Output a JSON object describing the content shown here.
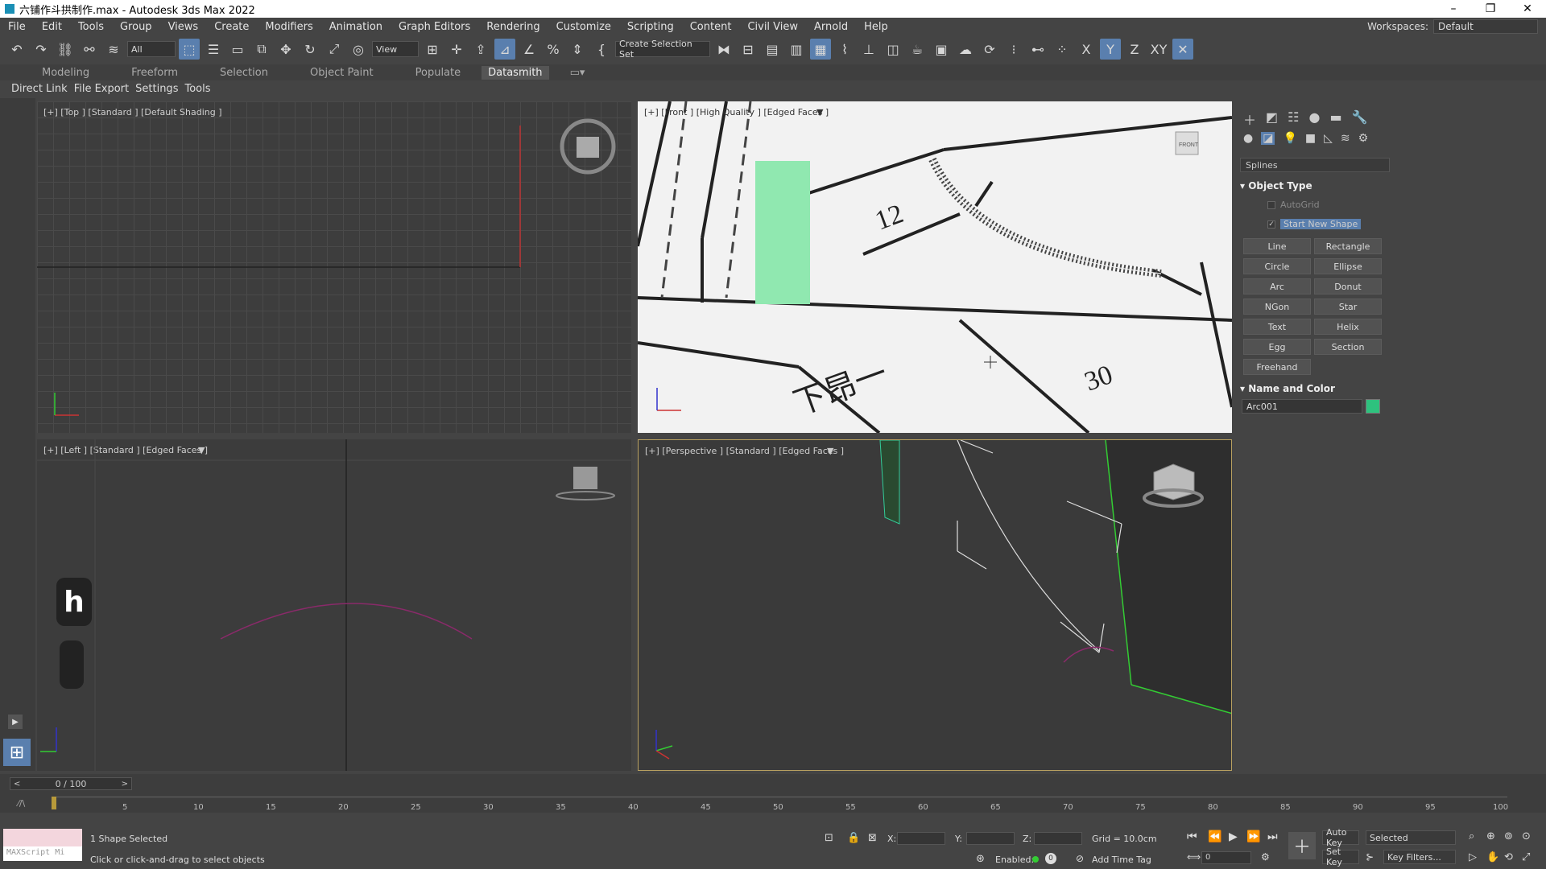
{
  "titlebar": {
    "title": "六铺作斗拱制作.max - Autodesk 3ds Max 2022",
    "minimize": "–",
    "maximize": "❐",
    "close": "✕"
  },
  "menu": [
    "File",
    "Edit",
    "Tools",
    "Group",
    "Views",
    "Create",
    "Modifiers",
    "Animation",
    "Graph Editors",
    "Rendering",
    "Customize",
    "Scripting",
    "Content",
    "Civil View",
    "Arnold",
    "Help"
  ],
  "workspaces": {
    "label": "Workspaces:",
    "value": "Default"
  },
  "toolbar": {
    "filter": "All",
    "view": "View",
    "selection_set": "Create Selection Set",
    "axis_x": "X",
    "axis_y": "Y",
    "axis_z": "Z",
    "axis_xy": "XY"
  },
  "ribbon_tabs": [
    "Modeling",
    "Freeform",
    "Selection",
    "Object Paint",
    "Populate",
    "Datasmith"
  ],
  "sub_ribbon": [
    "Direct Link",
    "File Export",
    "Settings",
    "Tools"
  ],
  "viewports": {
    "top": "[+] [Top ] [Standard ] [Default Shading ]",
    "front": "[+] [Front ] [High Quality ] [Edged Faces ]",
    "left": "[+] [Left ] [Standard ] [Edged Faces ]",
    "perspective": "[+] [Perspective ] [Standard ] [Edged Faces ]",
    "front_cube": "FRONT",
    "left_shortcut": "h",
    "drawing_texts": [
      "12",
      "下昂一",
      "30"
    ]
  },
  "command_panel": {
    "dropdown": "Splines",
    "object_type_title": "Object Type",
    "autogrid": "AutoGrid",
    "start_new_shape": "Start New Shape",
    "buttons": [
      "Line",
      "Rectangle",
      "Circle",
      "Ellipse",
      "Arc",
      "Donut",
      "NGon",
      "Star",
      "Text",
      "Helix",
      "Egg",
      "Section",
      "Freehand"
    ],
    "name_color_title": "Name and Color",
    "object_name": "Arc001",
    "object_color": "#2ec27e"
  },
  "timeline": {
    "slider": "0 / 100",
    "ticks": [
      "5",
      "10",
      "15",
      "20",
      "25",
      "30",
      "35",
      "40",
      "45",
      "50",
      "55",
      "60",
      "65",
      "70",
      "75",
      "80",
      "85",
      "90",
      "95",
      "100"
    ]
  },
  "status": {
    "selection": "1 Shape Selected",
    "prompt": "Click or click-and-drag to select objects",
    "maxscript": "MAXScript Mi",
    "x_label": "X:",
    "y_label": "Y:",
    "z_label": "Z:",
    "grid": "Grid = 10.0cm",
    "enabled": "Enabled:",
    "add_time_tag": "Add Time Tag",
    "auto_key": "Auto Key",
    "set_key": "Set Key",
    "key_mode": "Selected",
    "key_filters": "Key Filters...",
    "frame": "0"
  }
}
